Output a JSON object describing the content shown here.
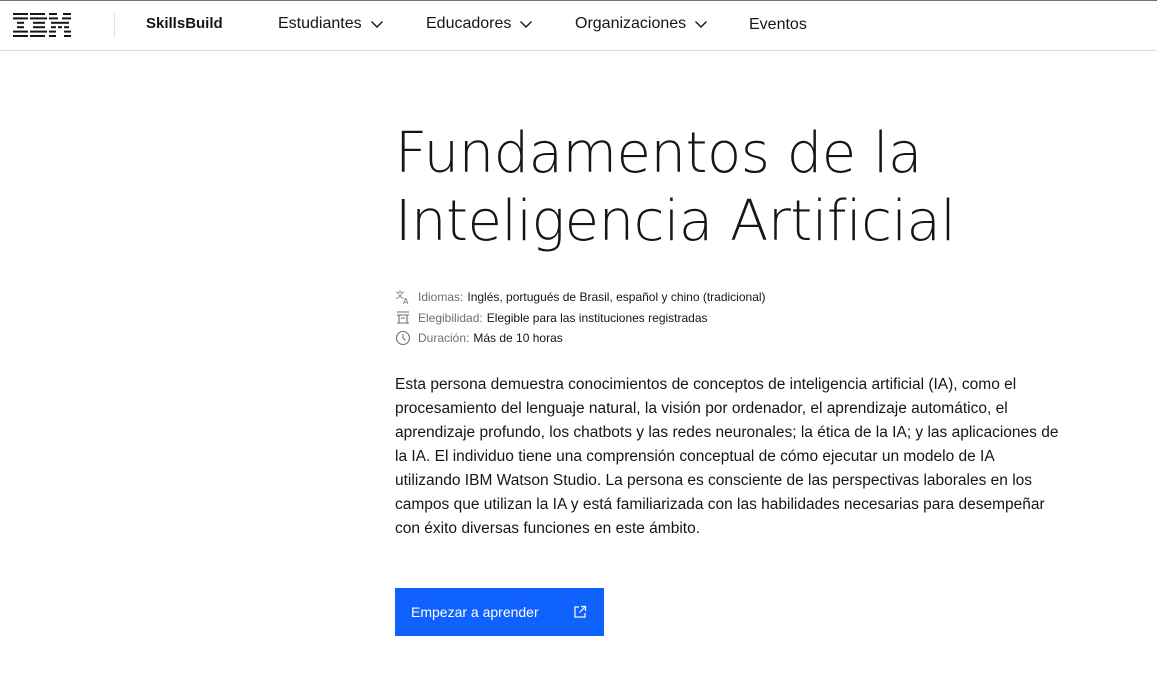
{
  "header": {
    "logo_text": "IBM",
    "brand": "SkillsBuild",
    "nav": [
      {
        "label": "Estudiantes",
        "has_dropdown": true
      },
      {
        "label": "Educadores",
        "has_dropdown": true
      },
      {
        "label": "Organizaciones",
        "has_dropdown": true
      },
      {
        "label": "Eventos",
        "has_dropdown": false
      }
    ]
  },
  "course": {
    "title_line1": "Fundamentos de la",
    "title_line2": "Inteligencia Artificial",
    "meta": [
      {
        "icon": "language-icon",
        "label": "Idiomas:",
        "value": "Inglés, portugués de Brasil, español y chino (tradicional)"
      },
      {
        "icon": "eligibility-icon",
        "label": "Elegibilidad:",
        "value": "Elegible para las instituciones registradas"
      },
      {
        "icon": "clock-icon",
        "label": "Duración:",
        "value": "Más de 10 horas"
      }
    ],
    "description": "Esta persona demuestra conocimientos de conceptos de inteligencia artificial (IA), como el procesamiento del lenguaje natural, la visión por ordenador, el aprendizaje automático, el aprendizaje profundo, los chatbots y las redes neuronales; la ética de la IA; y las aplicaciones de la IA. El individuo tiene una comprensión conceptual de cómo ejecutar un modelo de IA utilizando IBM Watson Studio. La persona es consciente de las perspectivas laborales en los campos que utilizan la IA y está familiarizada con las habilidades necesarias para desempeñar con éxito diversas funciones en este ámbito.",
    "cta_label": "Empezar a aprender",
    "cta_icon": "external-link-icon"
  },
  "colors": {
    "accent": "#0f62fe",
    "text": "#161616",
    "muted": "#6f6f6f"
  }
}
